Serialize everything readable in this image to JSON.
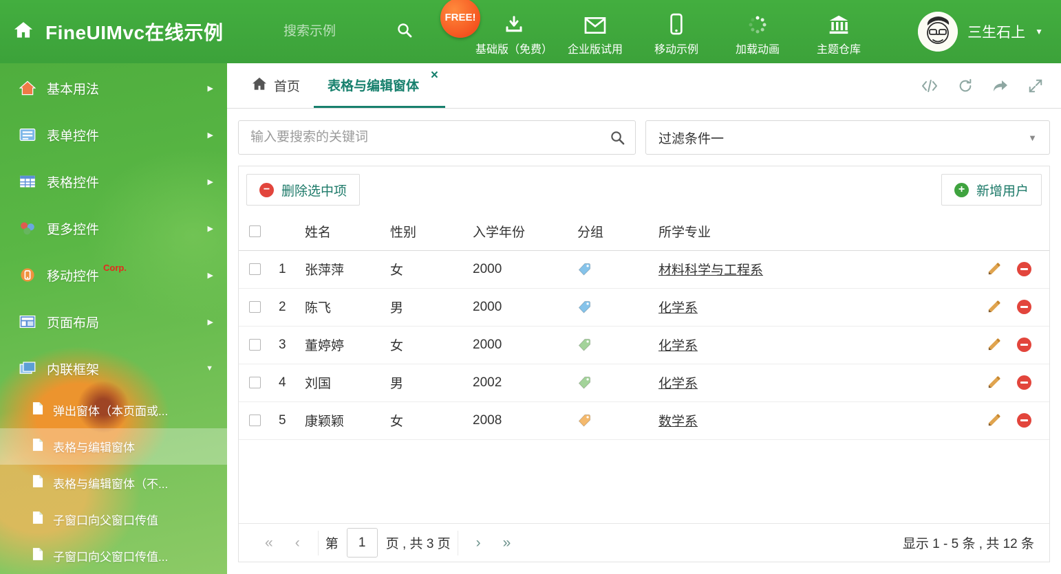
{
  "colors": {
    "header_green": "#3fa83c",
    "accent_teal": "#17806d",
    "danger_red": "#e2453c",
    "success_green": "#3fa33f",
    "pencil_orange": "#dfa44f"
  },
  "glyphs": {
    "chevron_right": "▶",
    "chevron_down": "▼",
    "caret_down": "▼",
    "close": "×",
    "minus": "−",
    "plus": "+",
    "first": "«",
    "prev": "‹",
    "next": "›",
    "last": "»"
  },
  "header": {
    "title": "FineUIMvc在线示例",
    "search_placeholder": "搜索示例",
    "free_badge": "FREE!",
    "nav": [
      {
        "label": "基础版（免费）"
      },
      {
        "label": "企业版试用"
      },
      {
        "label": "移动示例"
      },
      {
        "label": "加载动画"
      },
      {
        "label": "主题仓库"
      }
    ],
    "user_name": "三生石上"
  },
  "sidebar": {
    "items": [
      {
        "label": "基本用法"
      },
      {
        "label": "表单控件"
      },
      {
        "label": "表格控件"
      },
      {
        "label": "更多控件"
      },
      {
        "label": "移动控件",
        "badge": "Corp."
      },
      {
        "label": "页面布局"
      },
      {
        "label": "内联框架"
      }
    ],
    "subitems": [
      {
        "label": "弹出窗体（本页面或..."
      },
      {
        "label": "表格与编辑窗体"
      },
      {
        "label": "表格与编辑窗体（不..."
      },
      {
        "label": "子窗口向父窗口传值"
      },
      {
        "label": "子窗口向父窗口传值..."
      }
    ]
  },
  "tabs": {
    "home": "首页",
    "active": "表格与编辑窗体"
  },
  "filters": {
    "search_placeholder": "输入要搜索的关键词",
    "dropdown_value": "过滤条件一"
  },
  "toolbar": {
    "delete_label": "删除选中项",
    "add_label": "新增用户"
  },
  "table": {
    "headers": {
      "name": "姓名",
      "gender": "性别",
      "year": "入学年份",
      "group": "分组",
      "major": "所学专业"
    },
    "rows": [
      {
        "num": "1",
        "name": "张萍萍",
        "gender": "女",
        "year": "2000",
        "tag_color": "#85c3ea",
        "major": "材料科学与工程系"
      },
      {
        "num": "2",
        "name": "陈飞",
        "gender": "男",
        "year": "2000",
        "tag_color": "#85c3ea",
        "major": "化学系"
      },
      {
        "num": "3",
        "name": "董婷婷",
        "gender": "女",
        "year": "2000",
        "tag_color": "#a3d39a",
        "major": "化学系"
      },
      {
        "num": "4",
        "name": "刘国",
        "gender": "男",
        "year": "2002",
        "tag_color": "#a3d39a",
        "major": "化学系"
      },
      {
        "num": "5",
        "name": "康颖颖",
        "gender": "女",
        "year": "2008",
        "tag_color": "#f4b96d",
        "major": "数学系"
      }
    ]
  },
  "pagination": {
    "label_page": "第",
    "current_page": "1",
    "label_total": "页 , 共 3 页",
    "summary": "显示 1 - 5 条 , 共 12 条"
  }
}
